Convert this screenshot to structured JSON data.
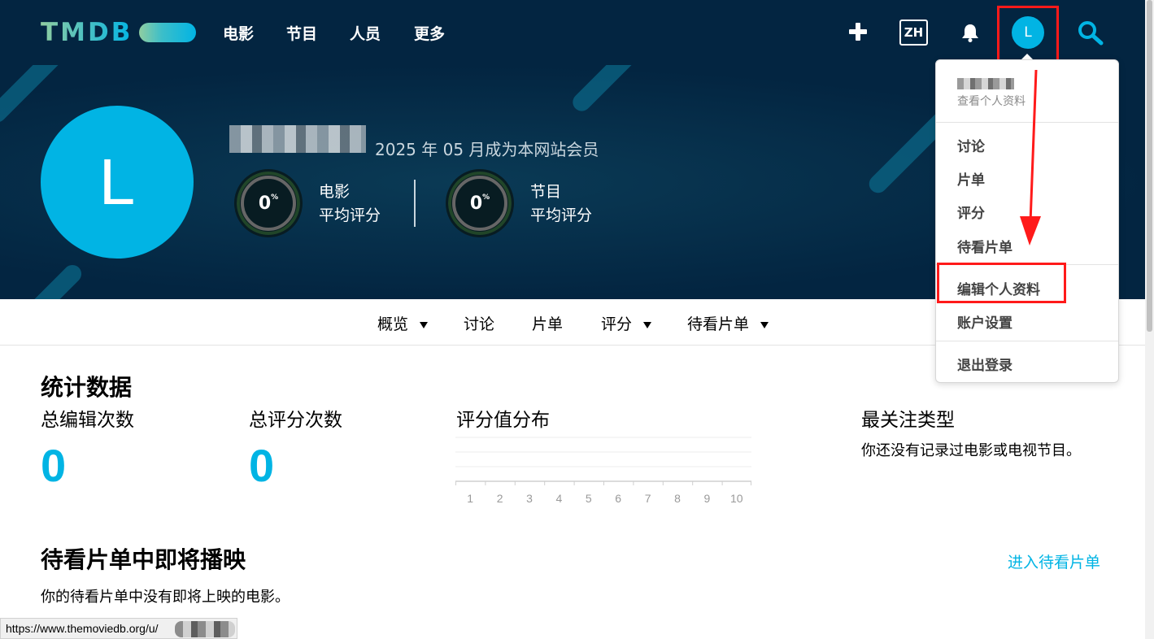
{
  "nav": {
    "logo": "TMDB",
    "items": [
      "电影",
      "节目",
      "人员",
      "更多"
    ],
    "lang": "ZH",
    "avatar_letter": "L"
  },
  "profile": {
    "avatar_letter": "L",
    "member_since": "2025 年 05 月成为本网站会员",
    "scores": [
      {
        "value": "0",
        "unit": "%",
        "label_line1": "电影",
        "label_line2": "平均评分"
      },
      {
        "value": "0",
        "unit": "%",
        "label_line1": "节目",
        "label_line2": "平均评分"
      }
    ]
  },
  "tabs": [
    {
      "label": "概览",
      "caret": true
    },
    {
      "label": "讨论",
      "caret": false
    },
    {
      "label": "片单",
      "caret": false
    },
    {
      "label": "评分",
      "caret": true
    },
    {
      "label": "待看片单",
      "caret": true
    }
  ],
  "stats": {
    "title": "统计数据",
    "edits_label": "总编辑次数",
    "edits_value": "0",
    "ratings_label": "总评分次数",
    "ratings_value": "0",
    "distribution_label": "评分值分布",
    "genre_label": "最关注类型",
    "genre_empty": "你还没有记录过电影或电视节目。"
  },
  "chart_data": {
    "type": "bar",
    "categories": [
      "1",
      "2",
      "3",
      "4",
      "5",
      "6",
      "7",
      "8",
      "9",
      "10"
    ],
    "values": [
      0,
      0,
      0,
      0,
      0,
      0,
      0,
      0,
      0,
      0
    ],
    "title": "评分值分布",
    "grid": true
  },
  "upcoming": {
    "title": "待看片单中即将播映",
    "link": "进入待看片单",
    "empty": "你的待看片单中没有即将上映的电影。"
  },
  "statusbar": {
    "url": "https://www.themoviedb.org/u/"
  },
  "dropdown": {
    "view_profile": "查看个人资料",
    "group1": [
      "讨论",
      "片单",
      "评分",
      "待看片单"
    ],
    "edit_profile": "编辑个人资料",
    "account_settings": "账户设置",
    "logout": "退出登录"
  },
  "colors": {
    "nav_bg": "#032541",
    "accent": "#01b4e4",
    "annotation": "#ff1a1a"
  }
}
